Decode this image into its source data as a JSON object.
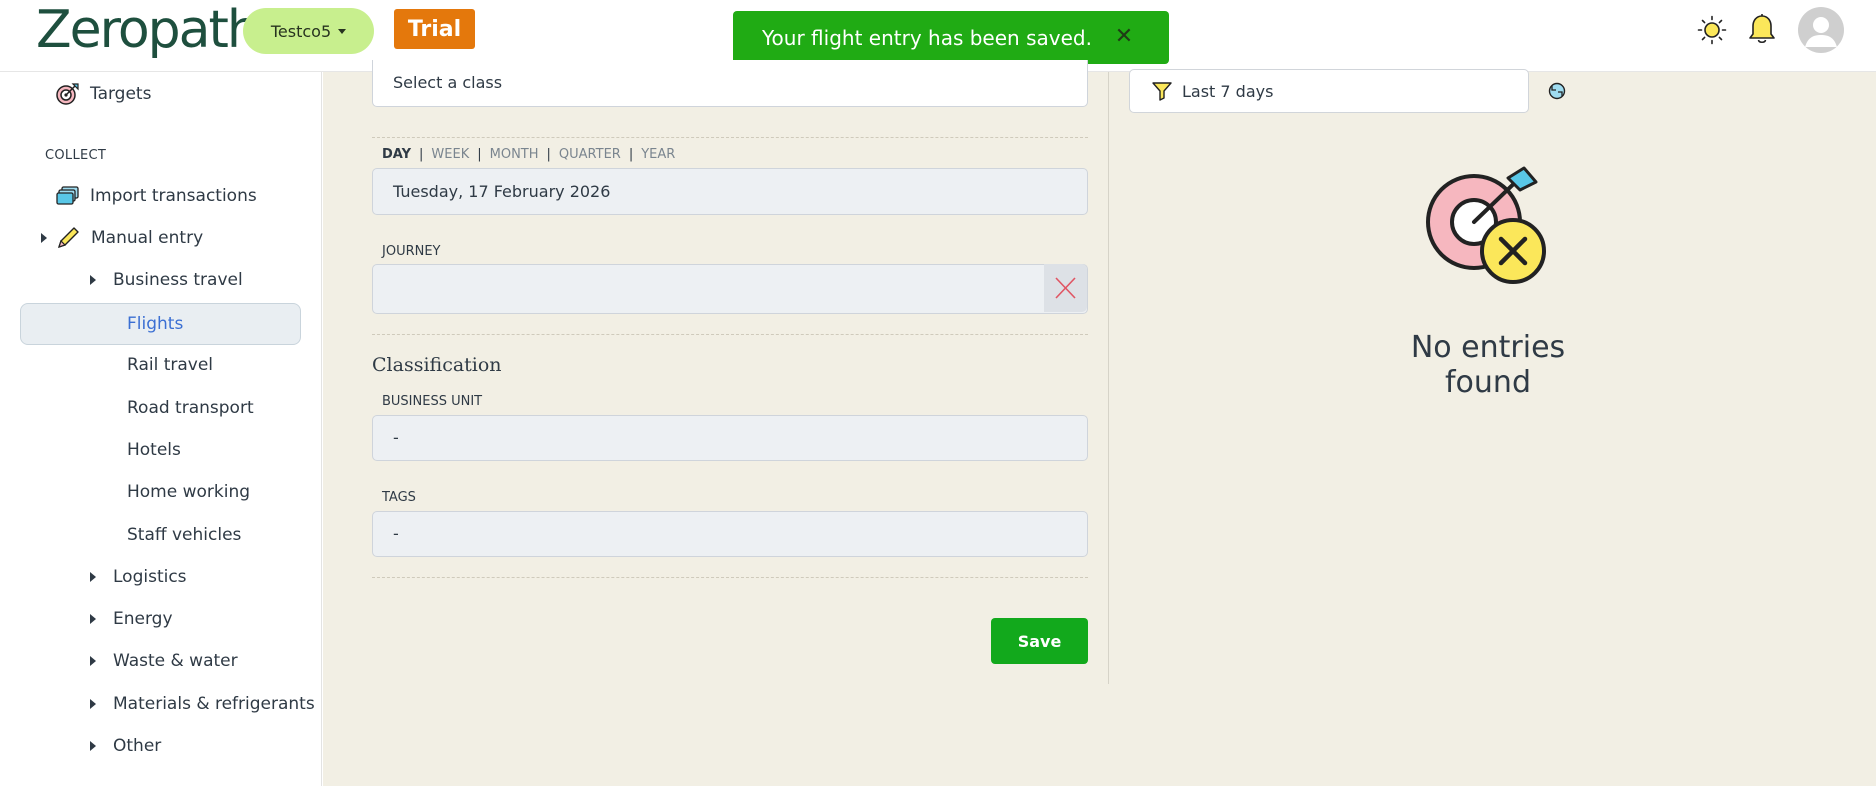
{
  "header": {
    "logo_text": "Zeropath",
    "org_label": "Testco5",
    "trial_label": "Trial",
    "toast_message": "Your flight entry has been saved.",
    "toast_close": "✕"
  },
  "sidebar": {
    "targets_label": "Targets",
    "section_collect": "COLLECT",
    "import_label": "Import transactions",
    "manual_entry_label": "Manual entry",
    "business_travel_label": "Business travel",
    "items": [
      {
        "label": "Flights",
        "active": true
      },
      {
        "label": "Rail travel"
      },
      {
        "label": "Road transport"
      },
      {
        "label": "Hotels"
      },
      {
        "label": "Home working"
      },
      {
        "label": "Staff vehicles"
      }
    ],
    "groups": [
      {
        "label": "Logistics"
      },
      {
        "label": "Energy"
      },
      {
        "label": "Waste & water"
      },
      {
        "label": "Materials & refrigerants"
      },
      {
        "label": "Other"
      }
    ]
  },
  "form": {
    "class_placeholder": "Select a class",
    "period_options": [
      "DAY",
      "WEEK",
      "MONTH",
      "QUARTER",
      "YEAR"
    ],
    "period_active": "DAY",
    "date_value": "Tuesday, 17 February 2026",
    "journey_label": "JOURNEY",
    "journey_value": "",
    "classification_heading": "Classification",
    "business_unit_label": "BUSINESS UNIT",
    "business_unit_value": "-",
    "tags_label": "TAGS",
    "tags_value": "-",
    "save_label": "Save"
  },
  "entries": {
    "filter_label": "Last 7 days",
    "empty_message": "No entries found"
  },
  "colors": {
    "toast_bg": "#20ab14",
    "trial_bg": "#e4780c",
    "org_bg": "#c8ef8e",
    "save_bg": "#12a91c",
    "main_bg": "#f2efe4"
  }
}
